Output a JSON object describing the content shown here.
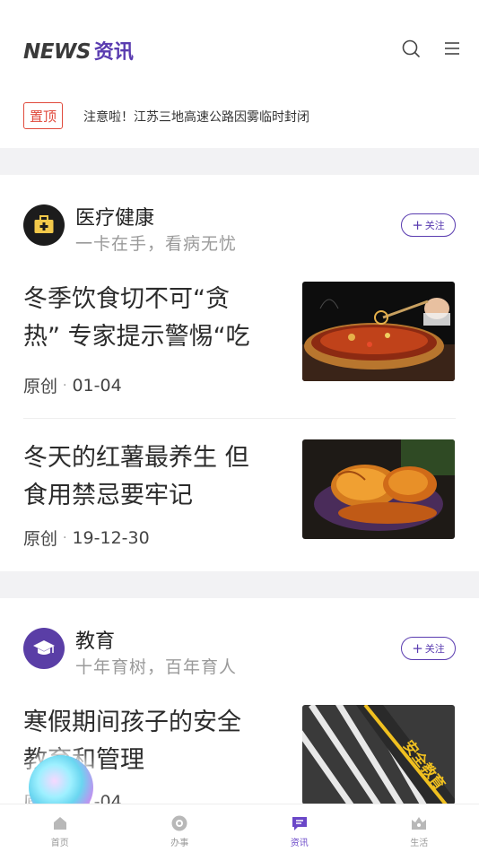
{
  "header": {
    "logo_news": "NEWS",
    "logo_cn": "资讯",
    "search_icon": "search-icon",
    "menu_icon": "menu-icon"
  },
  "notice": {
    "badge": "置顶",
    "text": "注意啦！江苏三地高速公路因雾临时封闭"
  },
  "sections": [
    {
      "icon": "medical-kit-icon",
      "icon_color": "#1c1c1c",
      "title": "医疗健康",
      "subtitle": "一卡在手，看病无忧",
      "follow_label": "关注",
      "articles": [
        {
          "title_line1": "冬季饮食切不可“贪",
          "title_line2": "热” 专家提示警惕“吃",
          "source": "原创",
          "date": "01-04",
          "image": "hotpot-image"
        },
        {
          "title_line1": "冬天的红薯最养生 但",
          "title_line2": "食用禁忌要牢记",
          "source": "原创",
          "date": "19-12-30",
          "image": "sweet-potato-image"
        }
      ]
    },
    {
      "icon": "graduation-cap-icon",
      "icon_color": "#5a3ea6",
      "title": "教育",
      "subtitle": "十年育树，百年育人",
      "follow_label": "关注",
      "articles": [
        {
          "title_line1": "寒假期间孩子的安全",
          "title_line2": "教育和管理",
          "source": "原创",
          "date": "01-04",
          "image": "safety-education-image",
          "image_text": "安全教育"
        }
      ]
    }
  ],
  "nav": [
    {
      "label": "首页",
      "icon": "home-icon",
      "active": false
    },
    {
      "label": "办事",
      "icon": "service-icon",
      "active": false
    },
    {
      "label": "资讯",
      "icon": "news-icon",
      "active": true
    },
    {
      "label": "生活",
      "icon": "life-icon",
      "active": false
    }
  ],
  "colors": {
    "accent": "#5a3cb0",
    "pin": "#e04a3c",
    "gap": "#f2f2f4"
  }
}
